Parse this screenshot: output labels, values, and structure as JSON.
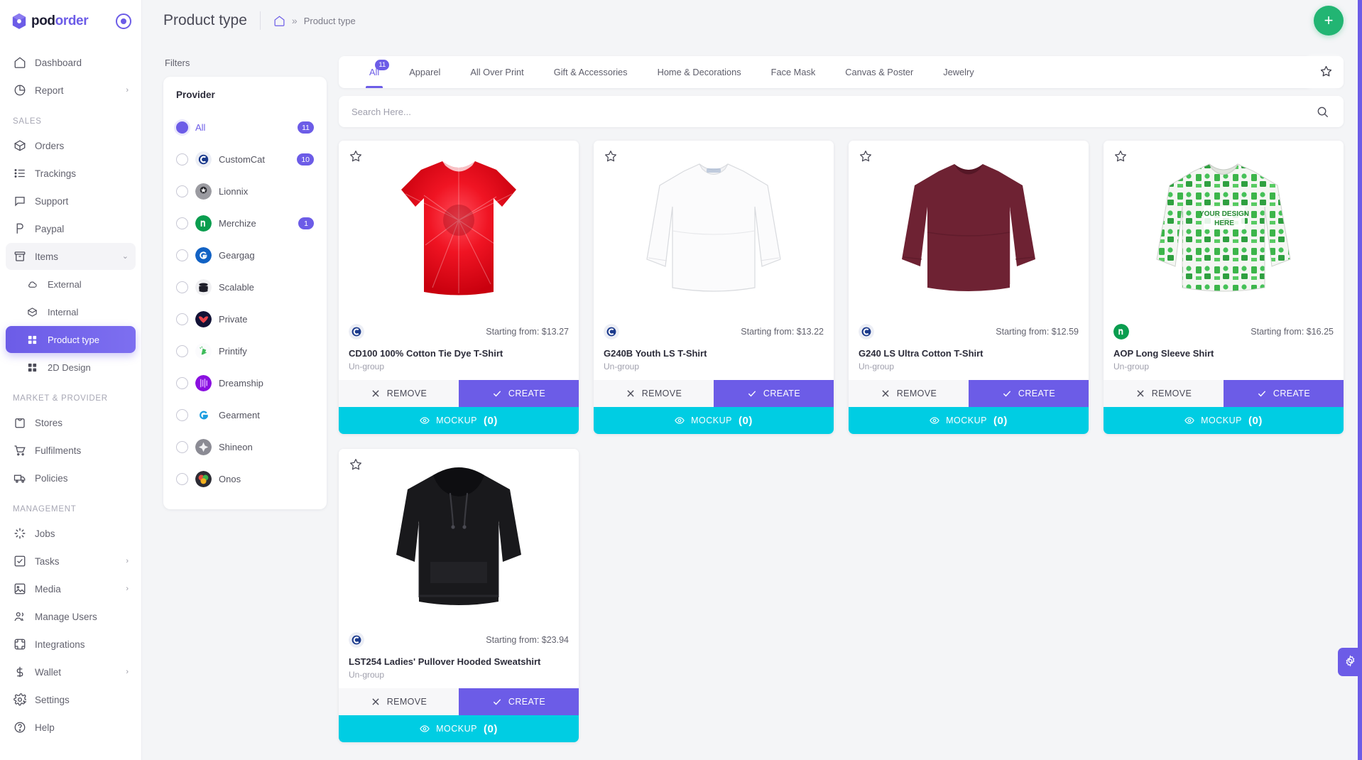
{
  "brand": {
    "name_part1": "pod",
    "name_part2": "order",
    "logo_icon": "cube-logo-icon",
    "status_icon": "target-icon"
  },
  "sidebar": {
    "items": [
      {
        "label": "Dashboard",
        "icon": "home-icon",
        "type": "item"
      },
      {
        "label": "Report",
        "icon": "pie-chart-icon",
        "type": "item",
        "chevron": "›"
      },
      {
        "label": "SALES",
        "type": "section"
      },
      {
        "label": "Orders",
        "icon": "box-icon",
        "type": "item"
      },
      {
        "label": "Trackings",
        "icon": "list-icon",
        "type": "item"
      },
      {
        "label": "Support",
        "icon": "chat-icon",
        "type": "item"
      },
      {
        "label": "Paypal",
        "icon": "paypal-icon",
        "type": "item"
      },
      {
        "label": "Items",
        "icon": "archive-icon",
        "type": "item",
        "chevron": "⌄",
        "expanded": true
      },
      {
        "label": "External",
        "icon": "cloud-icon",
        "type": "sub"
      },
      {
        "label": "Internal",
        "icon": "box-icon",
        "type": "sub"
      },
      {
        "label": "Product type",
        "icon": "grid-icon",
        "type": "sub",
        "active": true
      },
      {
        "label": "2D Design",
        "icon": "grid-icon",
        "type": "sub"
      },
      {
        "label": "MARKET & PROVIDER",
        "type": "section"
      },
      {
        "label": "Stores",
        "icon": "store-icon",
        "type": "item"
      },
      {
        "label": "Fulfilments",
        "icon": "cart-icon",
        "type": "item"
      },
      {
        "label": "Policies",
        "icon": "truck-icon",
        "type": "item"
      },
      {
        "label": "MANAGEMENT",
        "type": "section"
      },
      {
        "label": "Jobs",
        "icon": "spinner-icon",
        "type": "item"
      },
      {
        "label": "Tasks",
        "icon": "check-square-icon",
        "type": "item",
        "chevron": "›"
      },
      {
        "label": "Media",
        "icon": "image-icon",
        "type": "item",
        "chevron": "›"
      },
      {
        "label": "Manage Users",
        "icon": "users-icon",
        "type": "item"
      },
      {
        "label": "Integrations",
        "icon": "integration-icon",
        "type": "item"
      },
      {
        "label": "Wallet",
        "icon": "dollar-icon",
        "type": "item",
        "chevron": "›"
      },
      {
        "label": "Settings",
        "icon": "gear-icon",
        "type": "item"
      },
      {
        "label": "Help",
        "icon": "help-icon",
        "type": "item"
      }
    ]
  },
  "topbar": {
    "title": "Product type",
    "breadcrumb": {
      "home_icon": "home-icon",
      "separator": "»",
      "current": "Product type"
    },
    "add_button_label": "+"
  },
  "filters": {
    "label": "Filters",
    "provider_heading": "Provider",
    "providers": [
      {
        "name": "All",
        "badge": "11",
        "selected": true,
        "logo": "none"
      },
      {
        "name": "CustomCat",
        "badge": "10",
        "selected": false,
        "logo": "customcat"
      },
      {
        "name": "Lionnix",
        "badge": "",
        "selected": false,
        "logo": "lionnix"
      },
      {
        "name": "Merchize",
        "badge": "1",
        "selected": false,
        "logo": "merchize"
      },
      {
        "name": "Geargag",
        "badge": "",
        "selected": false,
        "logo": "geargag"
      },
      {
        "name": "Scalable",
        "badge": "",
        "selected": false,
        "logo": "scalable"
      },
      {
        "name": "Private",
        "badge": "",
        "selected": false,
        "logo": "private"
      },
      {
        "name": "Printify",
        "badge": "",
        "selected": false,
        "logo": "printify"
      },
      {
        "name": "Dreamship",
        "badge": "",
        "selected": false,
        "logo": "dreamship"
      },
      {
        "name": "Gearment",
        "badge": "",
        "selected": false,
        "logo": "gearment"
      },
      {
        "name": "Shineon",
        "badge": "",
        "selected": false,
        "logo": "shineon"
      },
      {
        "name": "Onos",
        "badge": "",
        "selected": false,
        "logo": "onos"
      }
    ]
  },
  "tabs": [
    {
      "label": "All",
      "badge": "11",
      "active": true
    },
    {
      "label": "Apparel",
      "badge": "",
      "active": false
    },
    {
      "label": "All Over Print",
      "badge": "",
      "active": false
    },
    {
      "label": "Gift & Accessories",
      "badge": "",
      "active": false
    },
    {
      "label": "Home & Decorations",
      "badge": "",
      "active": false
    },
    {
      "label": "Face Mask",
      "badge": "",
      "active": false
    },
    {
      "label": "Canvas & Poster",
      "badge": "",
      "active": false
    },
    {
      "label": "Jewelry",
      "badge": "",
      "active": false
    }
  ],
  "favorite_button_icon": "star-icon",
  "search": {
    "placeholder": "Search Here...",
    "value": "",
    "icon": "search-icon"
  },
  "card_buttons": {
    "remove": "REMOVE",
    "create": "CREATE",
    "mockup": "MOCKUP",
    "mockup_count": "(0)"
  },
  "products": [
    {
      "name": "CD100 100% Cotton Tie Dye T-Shirt",
      "group": "Un-group",
      "price_label": "Starting from: $13.27",
      "provider_logo": "customcat",
      "image": "tiedye-tshirt-red"
    },
    {
      "name": "G240B Youth LS T-Shirt",
      "group": "Un-group",
      "price_label": "Starting from: $13.22",
      "provider_logo": "customcat",
      "image": "longsleeve-white"
    },
    {
      "name": "G240 LS Ultra Cotton T-Shirt",
      "group": "Un-group",
      "price_label": "Starting from: $12.59",
      "provider_logo": "customcat",
      "image": "longsleeve-maroon"
    },
    {
      "name": "AOP Long Sleeve Shirt",
      "group": "Un-group",
      "price_label": "Starting from: $16.25",
      "provider_logo": "merchize",
      "image": "aop-longsleeve-pattern"
    },
    {
      "name": "LST254 Ladies' Pullover Hooded Sweatshirt",
      "group": "Un-group",
      "price_label": "Starting from: $23.94",
      "provider_logo": "customcat",
      "image": "hoodie-black"
    }
  ],
  "settings_fab_icon": "gear-icon",
  "colors": {
    "accent": "#6c5ce7",
    "mockup": "#00cde3",
    "add": "#22b573",
    "bg": "#f4f5f7"
  }
}
